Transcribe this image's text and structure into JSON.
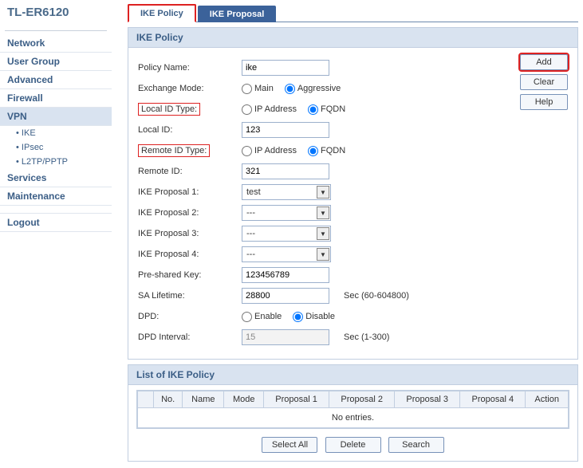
{
  "device": "TL-ER6120",
  "nav": {
    "network": "Network",
    "usergroup": "User Group",
    "advanced": "Advanced",
    "firewall": "Firewall",
    "vpn": "VPN",
    "ike": "IKE",
    "ipsec": "IPsec",
    "l2tp": "L2TP/PPTP",
    "services": "Services",
    "maintenance": "Maintenance",
    "logout": "Logout"
  },
  "tabs": {
    "policy": "IKE Policy",
    "proposal": "IKE Proposal"
  },
  "section": {
    "ikepolicy": "IKE Policy",
    "listpolicy": "List of IKE Policy"
  },
  "labels": {
    "policyName": "Policy Name:",
    "exchangeMode": "Exchange Mode:",
    "localIdType": "Local ID Type:",
    "localId": "Local ID:",
    "remoteIdType": "Remote ID Type:",
    "remoteId": "Remote ID:",
    "prop1": "IKE Proposal 1:",
    "prop2": "IKE Proposal 2:",
    "prop3": "IKE Proposal 3:",
    "prop4": "IKE Proposal 4:",
    "psk": "Pre-shared Key:",
    "saLifetime": "SA Lifetime:",
    "dpd": "DPD:",
    "dpdInterval": "DPD Interval:"
  },
  "values": {
    "policyName": "ike",
    "localId": "123",
    "remoteId": "321",
    "prop1": "test",
    "prop2": "---",
    "prop3": "---",
    "prop4": "---",
    "psk": "123456789",
    "saLifetime": "28800",
    "dpdInterval": "15"
  },
  "radios": {
    "main": "Main",
    "aggressive": "Aggressive",
    "ipaddr": "IP Address",
    "fqdn": "FQDN",
    "enable": "Enable",
    "disable": "Disable"
  },
  "suffix": {
    "saLifetime": "Sec (60-604800)",
    "dpdInterval": "Sec (1-300)"
  },
  "buttons": {
    "add": "Add",
    "clear": "Clear",
    "help": "Help",
    "selectAll": "Select All",
    "delete": "Delete",
    "search": "Search"
  },
  "table": {
    "no": "No.",
    "name": "Name",
    "mode": "Mode",
    "p1": "Proposal 1",
    "p2": "Proposal 2",
    "p3": "Proposal 3",
    "p4": "Proposal 4",
    "action": "Action",
    "empty": "No entries."
  }
}
